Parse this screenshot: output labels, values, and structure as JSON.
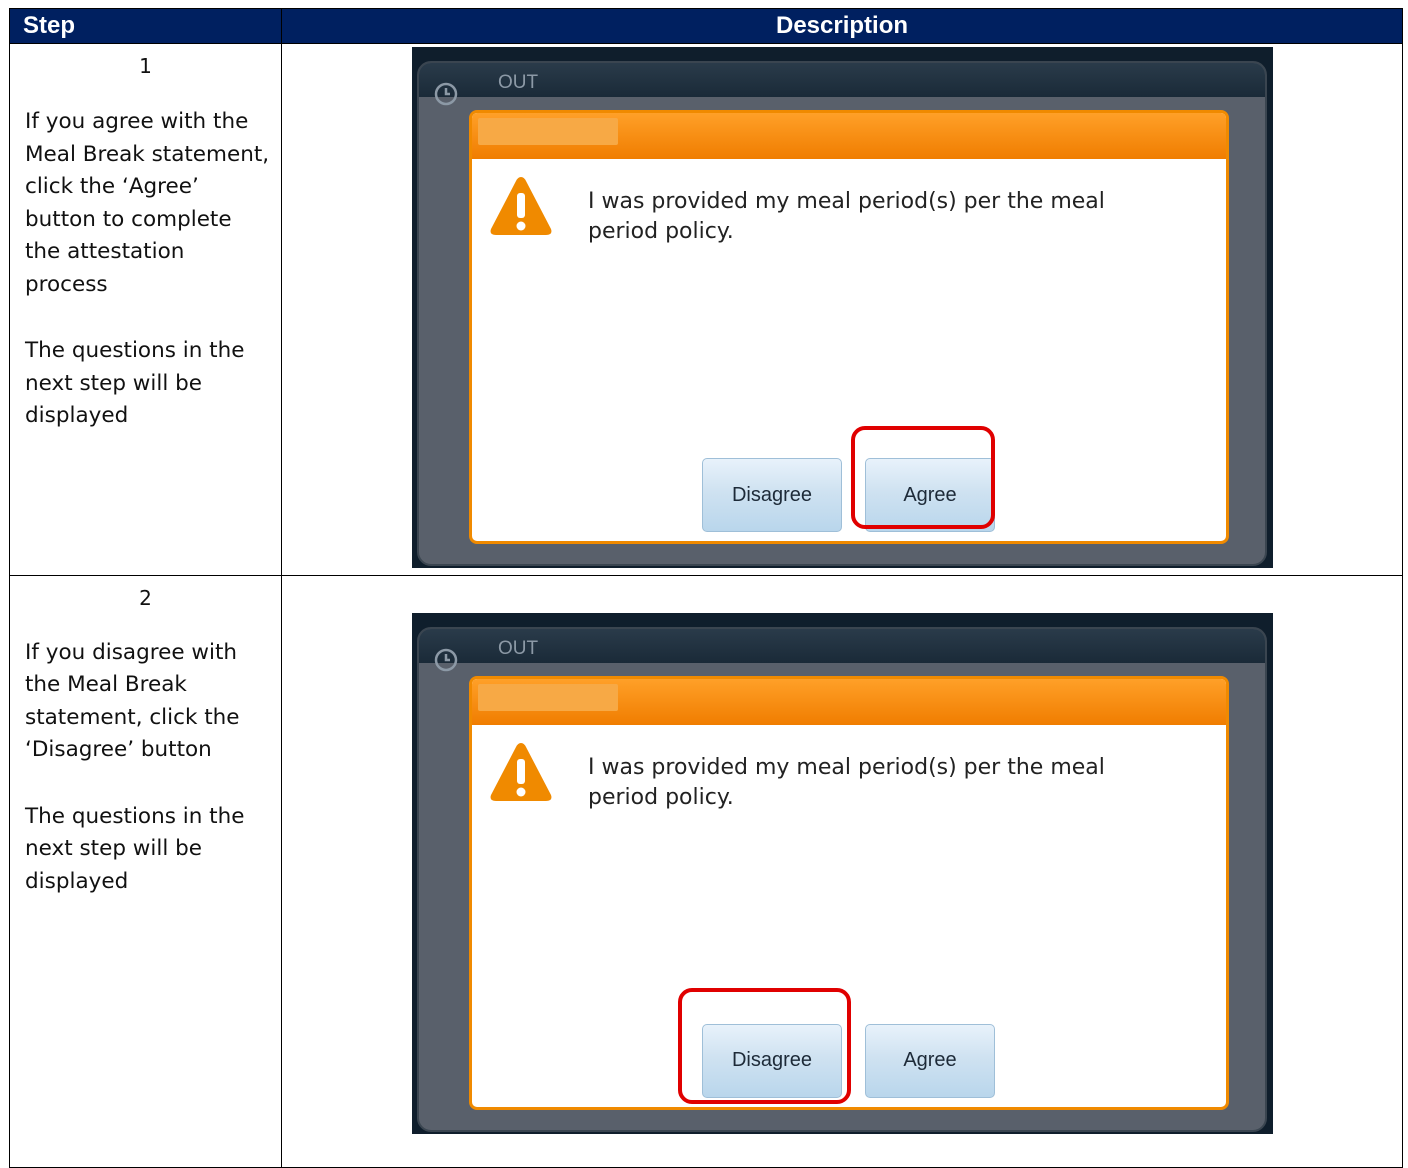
{
  "header": {
    "step": "Step",
    "description": "Description"
  },
  "rows": [
    {
      "number": "1",
      "paragraphs": [
        "If you agree with the Meal Break statement, click the ‘Agree’ button to complete the attestation process",
        "The questions in the next step will be displayed"
      ],
      "screen": {
        "status_label": "OUT",
        "message": "I was provided my meal period(s) per the meal period policy.",
        "disagree_label": "Disagree",
        "agree_label": "Agree",
        "highlighted_button": "Agree"
      }
    },
    {
      "number": "2",
      "paragraphs": [
        "If you disagree with the Meal Break statement, click the ‘Disagree’ button",
        "The questions in the next step will be displayed"
      ],
      "screen": {
        "status_label": "OUT",
        "message": "I was provided my meal period(s) per the meal period policy.",
        "disagree_label": "Disagree",
        "agree_label": "Agree",
        "highlighted_button": "Disagree"
      }
    }
  ],
  "colors": {
    "header_bg": "#002060",
    "dialog_orange": "#f08a00",
    "highlight_red": "#e00000"
  }
}
